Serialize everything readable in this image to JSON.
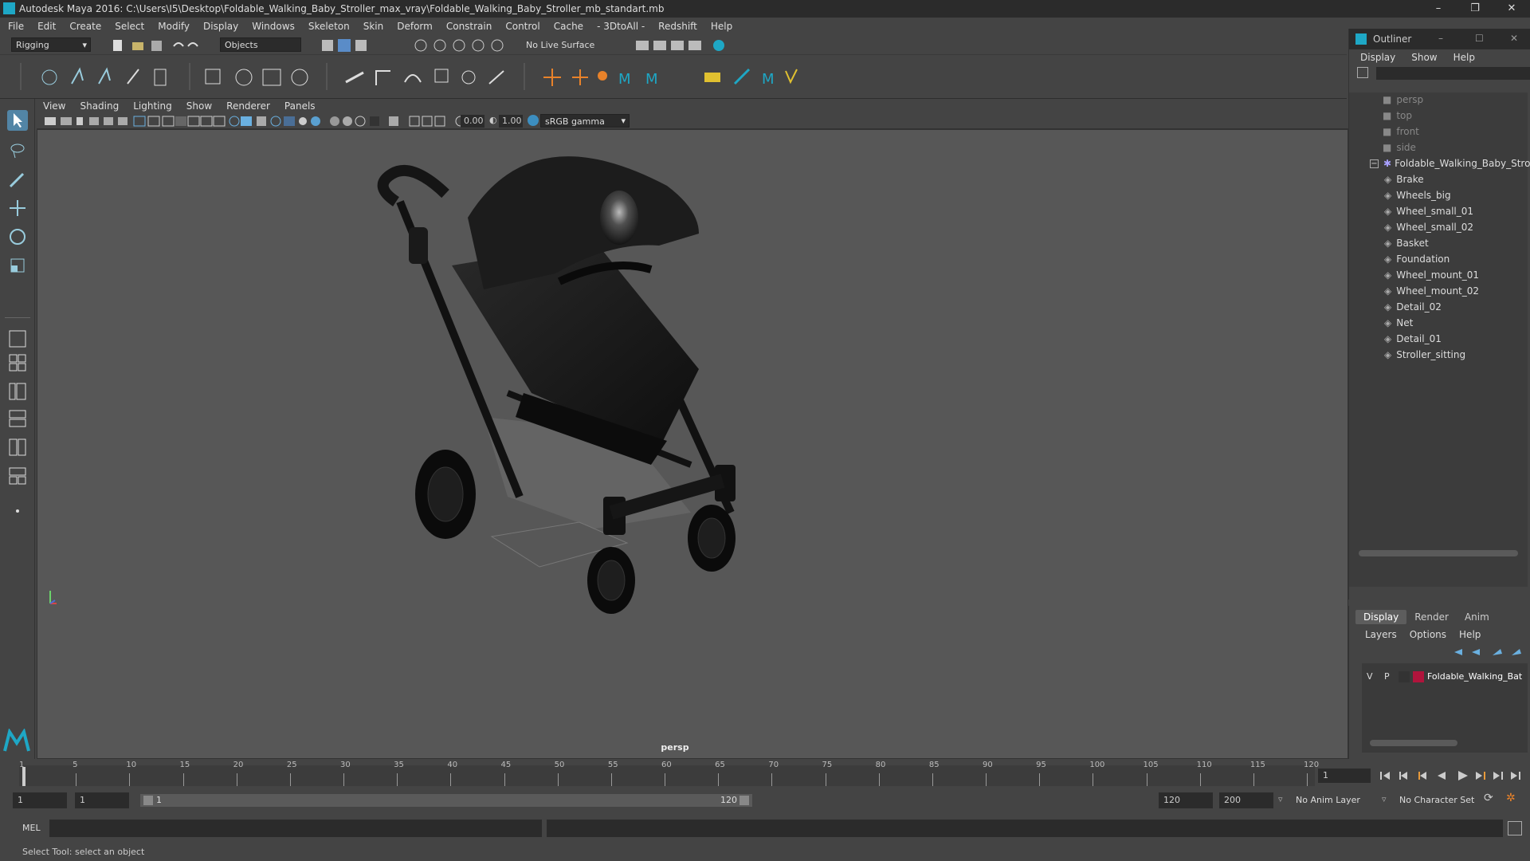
{
  "window": {
    "title": "Autodesk Maya 2016: C:\\Users\\I5\\Desktop\\Foldable_Walking_Baby_Stroller_max_vray\\Foldable_Walking_Baby_Stroller_mb_standart.mb",
    "minimize": "–",
    "restore": "❐",
    "close": "✕"
  },
  "menubar": [
    "File",
    "Edit",
    "Create",
    "Select",
    "Modify",
    "Display",
    "Windows",
    "Skeleton",
    "Skin",
    "Deform",
    "Constrain",
    "Control",
    "Cache",
    "- 3DtoAll -",
    "Redshift",
    "Help"
  ],
  "statusline": {
    "menuset": "Rigging",
    "selection_mode": "Objects",
    "live_surface": "No Live Surface"
  },
  "viewport": {
    "menu": [
      "View",
      "Shading",
      "Lighting",
      "Show",
      "Renderer",
      "Panels"
    ],
    "exposure": "0.00",
    "gamma": "1.00",
    "colorspace": "sRGB gamma",
    "camera_label": "persp"
  },
  "outliner": {
    "title": "Outliner",
    "menu": [
      "Display",
      "Show",
      "Help"
    ],
    "cameras": [
      "persp",
      "top",
      "front",
      "side"
    ],
    "root": "Foldable_Walking_Baby_Stro",
    "children": [
      "Brake",
      "Wheels_big",
      "Wheel_small_01",
      "Wheel_small_02",
      "Basket",
      "Foundation",
      "Wheel_mount_01",
      "Wheel_mount_02",
      "Detail_02",
      "Net",
      "Detail_01",
      "Stroller_sitting"
    ]
  },
  "layers": {
    "tabs": [
      "Display",
      "Render",
      "Anim"
    ],
    "menu": [
      "Layers",
      "Options",
      "Help"
    ],
    "row": {
      "v": "V",
      "p": "P",
      "name": "Foldable_Walking_Bat",
      "color": "#b0143c"
    }
  },
  "timeline": {
    "ticks": [
      "1",
      "5",
      "10",
      "15",
      "20",
      "25",
      "30",
      "35",
      "40",
      "45",
      "50",
      "55",
      "60",
      "65",
      "70",
      "75",
      "80",
      "85",
      "90",
      "95",
      "100",
      "105",
      "110",
      "115",
      "120"
    ],
    "current_frame": "1"
  },
  "range": {
    "start": "1",
    "anim_start": "1",
    "slider_start": "1",
    "slider_end": "120",
    "end": "120",
    "anim_end": "200",
    "anim_layer": "No Anim Layer",
    "character_set": "No Character Set"
  },
  "mel": {
    "label": "MEL"
  },
  "status": {
    "help": "Select Tool: select an object"
  }
}
